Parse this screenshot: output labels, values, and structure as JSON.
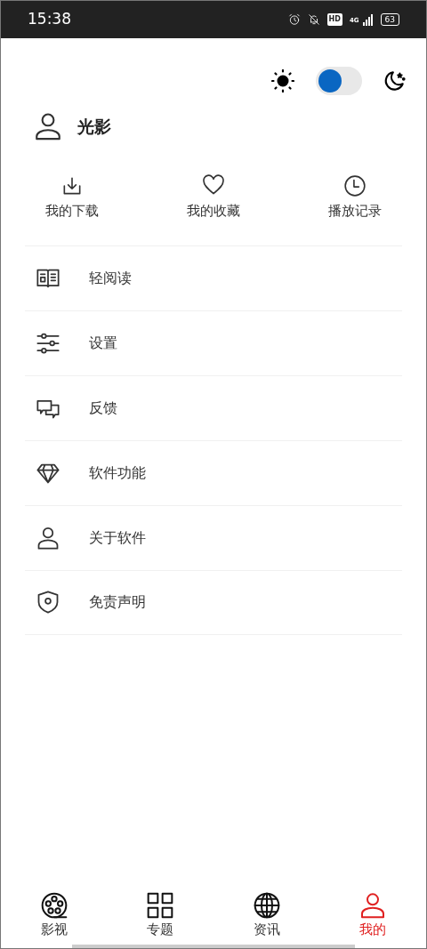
{
  "status_bar": {
    "time": "15:38",
    "hd": "HD",
    "network": "4G",
    "battery": "63"
  },
  "theme_toggle": {
    "dark_mode": false
  },
  "profile": {
    "name": "光影"
  },
  "quick_actions": [
    {
      "kind": "download",
      "label": "我的下载"
    },
    {
      "kind": "favorite",
      "label": "我的收藏"
    },
    {
      "kind": "history",
      "label": "播放记录"
    }
  ],
  "menu": [
    {
      "kind": "book",
      "label": "轻阅读"
    },
    {
      "kind": "sliders",
      "label": "设置"
    },
    {
      "kind": "chat",
      "label": "反馈"
    },
    {
      "kind": "diamond",
      "label": "软件功能"
    },
    {
      "kind": "person",
      "label": "关于软件"
    },
    {
      "kind": "shield",
      "label": "免责声明"
    }
  ],
  "bottom_nav": [
    {
      "kind": "film",
      "label": "影视",
      "selected": false
    },
    {
      "kind": "grid",
      "label": "专题",
      "selected": false
    },
    {
      "kind": "globe",
      "label": "资讯",
      "selected": false
    },
    {
      "kind": "person",
      "label": "我的",
      "selected": true
    }
  ]
}
